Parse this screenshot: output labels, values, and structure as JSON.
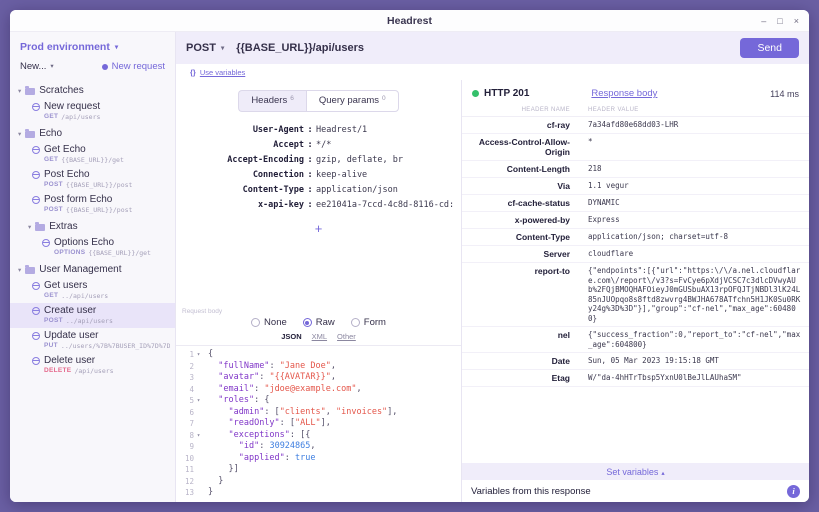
{
  "window": {
    "title": "Headrest",
    "minimize": "–",
    "maximize": "□",
    "close": "×"
  },
  "colors": {
    "accent": "#7568d9",
    "status_green": "#34c06b",
    "delete_method": "#e4698c"
  },
  "sidebar": {
    "environment": "Prod environment",
    "new_label": "New...",
    "new_request_label": "New request",
    "tree": [
      {
        "kind": "folder",
        "depth": 0,
        "label": "Scratches"
      },
      {
        "kind": "request",
        "depth": 1,
        "label": "New request",
        "method": "GET",
        "path": "/api/users"
      },
      {
        "kind": "folder",
        "depth": 0,
        "label": "Echo"
      },
      {
        "kind": "request",
        "depth": 1,
        "label": "Get Echo",
        "method": "GET",
        "path": "{{BASE_URL}}/get"
      },
      {
        "kind": "request",
        "depth": 1,
        "label": "Post Echo",
        "method": "POST",
        "path": "{{BASE_URL}}/post"
      },
      {
        "kind": "request",
        "depth": 1,
        "label": "Post form Echo",
        "method": "POST",
        "path": "{{BASE_URL}}/post"
      },
      {
        "kind": "folder",
        "depth": 1,
        "label": "Extras"
      },
      {
        "kind": "request",
        "depth": 2,
        "label": "Options Echo",
        "method": "OPTIONS",
        "path": "{{BASE_URL}}/get"
      },
      {
        "kind": "folder",
        "depth": 0,
        "label": "User Management"
      },
      {
        "kind": "request",
        "depth": 1,
        "label": "Get users",
        "method": "GET",
        "path": "../api/users"
      },
      {
        "kind": "request",
        "depth": 1,
        "label": "Create user",
        "method": "POST",
        "path": "../api/users",
        "selected": true
      },
      {
        "kind": "request",
        "depth": 1,
        "label": "Update user",
        "method": "PUT",
        "path": "../users/%7B%7BUSER_ID%7D%7D"
      },
      {
        "kind": "request",
        "depth": 1,
        "label": "Delete user",
        "method": "DELETE",
        "path": "/api/users"
      }
    ]
  },
  "request": {
    "method": "POST",
    "url": "{{BASE_URL}}/api/users",
    "send_label": "Send",
    "use_variables_icon": "{}",
    "use_variables_label": "Use variables",
    "tabs": [
      {
        "label": "Headers",
        "count": "6"
      },
      {
        "label": "Query params",
        "count": "0"
      }
    ],
    "headers": [
      {
        "name": "User-Agent",
        "value": "Headrest/1"
      },
      {
        "name": "Accept",
        "value": "*/*"
      },
      {
        "name": "Accept-Encoding",
        "value": "gzip, deflate, br"
      },
      {
        "name": "Connection",
        "value": "keep-alive"
      },
      {
        "name": "Content-Type",
        "value": "application/json"
      },
      {
        "name": "x-api-key",
        "value": "ee21041a-7ccd-4c8d-8116-cd:"
      }
    ],
    "add_label": "+",
    "body": {
      "section_label": "Request body",
      "modes": [
        "None",
        "Raw",
        "Form"
      ],
      "selected_mode": "Raw",
      "formats": [
        "JSON",
        "XML",
        "Other"
      ],
      "selected_format": "JSON",
      "lines": [
        "{",
        "  \"fullName\": \"Jane Doe\",",
        "  \"avatar\": \"{{AVATAR}}\",",
        "  \"email\": \"jdoe@example.com\",",
        "  \"roles\": {",
        "    \"admin\": [\"clients\", \"invoices\"],",
        "    \"readOnly\": [\"ALL\"],",
        "    \"exceptions\": [{",
        "      \"id\": 30924865,",
        "      \"applied\": true",
        "    }]",
        "  }",
        "}"
      ]
    }
  },
  "response": {
    "status_label": "HTTP 201",
    "body_link_label": "Response body",
    "time": "114 ms",
    "name_header": "HEADER NAME",
    "value_header": "HEADER VALUE",
    "rows": [
      {
        "name": "cf-ray",
        "value": "7a34afd80e68dd03-LHR"
      },
      {
        "name": "Access-Control-Allow-Origin",
        "value": "*"
      },
      {
        "name": "Content-Length",
        "value": "218"
      },
      {
        "name": "Via",
        "value": "1.1 vegur"
      },
      {
        "name": "cf-cache-status",
        "value": "DYNAMIC"
      },
      {
        "name": "x-powered-by",
        "value": "Express"
      },
      {
        "name": "Content-Type",
        "value": "application/json; charset=utf-8"
      },
      {
        "name": "Server",
        "value": "cloudflare"
      },
      {
        "name": "report-to",
        "value": "{\"endpoints\":[{\"url\":\"https:\\/\\/a.nel.cloudflare.com\\/report\\/v3?s=FvCye6pXdjVCSC7c3dlcDVwyAUb%2FQjBMOQHAFOieyJ0mGUSbuAX13rpOFQJTjNBDl3lK24L85nJUOpqo8s8ftd8zwvrg4BWJHA678ATfchn5H1JK0Su0RKy24g%3D%3D\"}],\"group\":\"cf-nel\",\"max_age\":604800}"
      },
      {
        "name": "nel",
        "value": "{\"success_fraction\":0,\"report_to\":\"cf-nel\",\"max_age\":604800}"
      },
      {
        "name": "Date",
        "value": "Sun, 05 Mar 2023 19:15:18 GMT"
      },
      {
        "name": "Etag",
        "value": "W/\"da-4hHTrTbsp5YxnU0lBeJlLAUhaSM\""
      }
    ],
    "set_variables_label": "Set variables",
    "variables_label": "Variables from this response",
    "info_icon": "i"
  }
}
